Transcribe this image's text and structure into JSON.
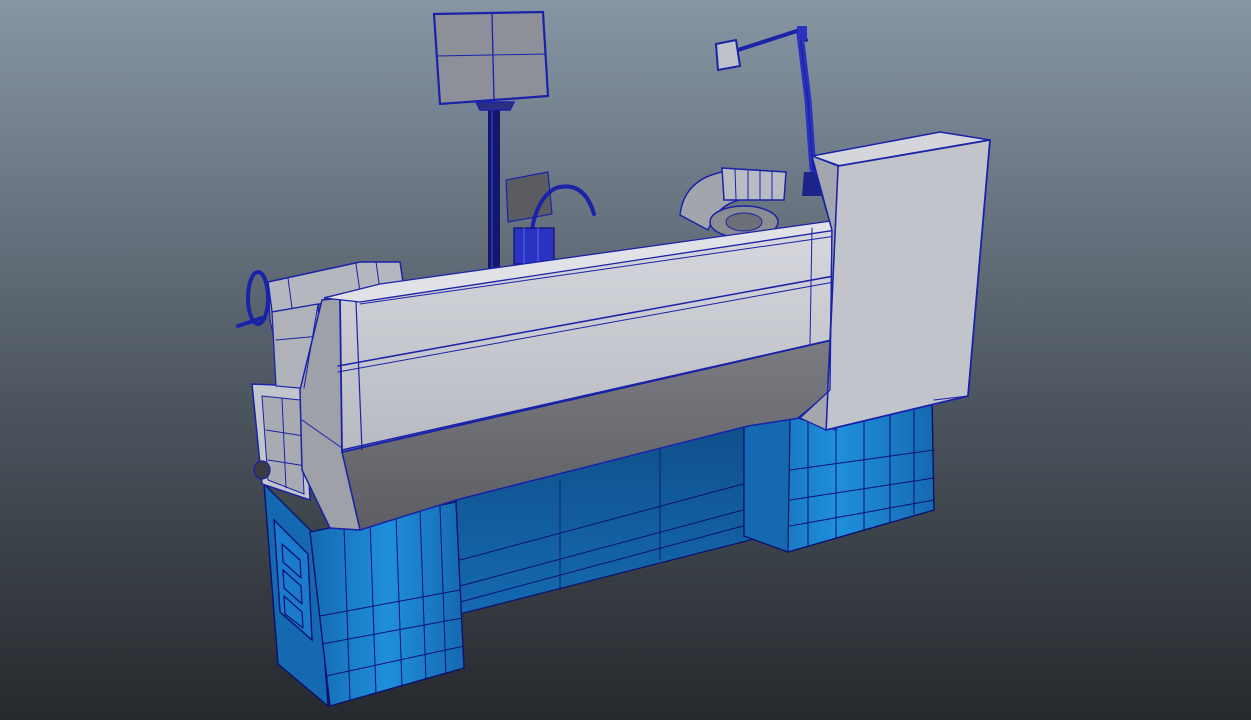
{
  "scene": {
    "subject": "lathe-machine-wireframe-render",
    "colors": {
      "bg_top": "#8795a4",
      "bg_mid": "#4d5660",
      "bg_bottom": "#26292d",
      "base_blue": "#1f8fdc",
      "base_blue_dark": "#1569b0",
      "base_blue_shadow": "#0f4f8a",
      "body_light": "#c9cbd2",
      "body_mid": "#a7a9b0",
      "body_dark": "#75767c",
      "body_shadow": "#595a60",
      "wire": "#1a22a8",
      "wire_dark": "#0c1070"
    }
  }
}
